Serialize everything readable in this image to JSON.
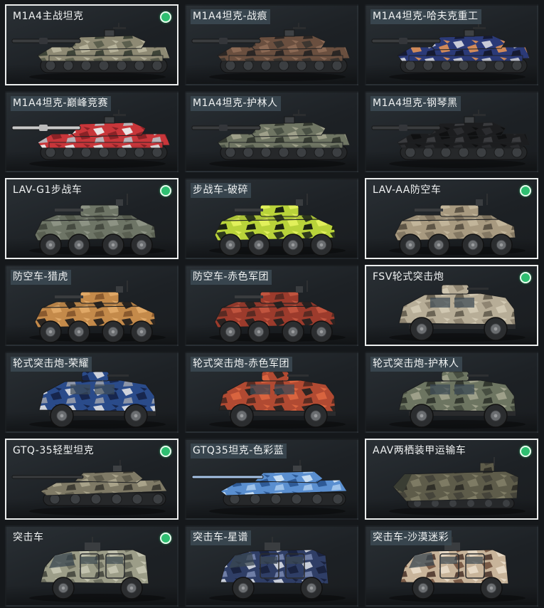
{
  "items": [
    {
      "name": "M1A4主战坦克",
      "type": "tank",
      "owned": true,
      "selected": true,
      "camo": [
        "#8e8a74",
        "#5c5f4e",
        "#b7b39b",
        "#3e4438"
      ]
    },
    {
      "name": "M1A4坦克-战痕",
      "type": "tank",
      "owned": false,
      "selected": false,
      "camo": [
        "#6a4f3f",
        "#3d3630",
        "#8c6a55",
        "#2b2624"
      ]
    },
    {
      "name": "M1A4坦克-哈夫克重工",
      "type": "tank",
      "owned": false,
      "selected": false,
      "camo": [
        "#2b3a78",
        "#c9ccd8",
        "#d08a5a",
        "#151a33"
      ]
    },
    {
      "name": "M1A4坦克-巅峰竞赛",
      "type": "tank",
      "owned": false,
      "selected": false,
      "camo": [
        "#c8363a",
        "#e9e4e4",
        "#8a2226",
        "#b9b3b8"
      ]
    },
    {
      "name": "M1A4坦克-护林人",
      "type": "tank",
      "owned": false,
      "selected": false,
      "camo": [
        "#6f7563",
        "#4a5145",
        "#9fa08a",
        "#353a31"
      ]
    },
    {
      "name": "M1A4坦克-钢琴黑",
      "type": "tank",
      "owned": false,
      "selected": false,
      "camo": [
        "#1c1d1f",
        "#2b2c2f",
        "#0f1011",
        "#3a3b3e"
      ]
    },
    {
      "name": "LAV-G1步战车",
      "type": "ifv",
      "owned": true,
      "selected": true,
      "camo": [
        "#6e7566",
        "#5a6052",
        "#8d9384",
        "#454a40"
      ]
    },
    {
      "name": "步战车-破碎",
      "type": "ifv",
      "owned": false,
      "selected": false,
      "camo": [
        "#b9d33a",
        "#2f3a1c",
        "#e1f05b",
        "#1c2312"
      ]
    },
    {
      "name": "LAV-AA防空车",
      "type": "ifv",
      "owned": true,
      "selected": true,
      "camo": [
        "#a89a80",
        "#847863",
        "#c2b59a",
        "#5e5546"
      ]
    },
    {
      "name": "防空车-猎虎",
      "type": "ifv",
      "owned": false,
      "selected": false,
      "camo": [
        "#c48a4a",
        "#2b2520",
        "#e0a866",
        "#8a5a2e"
      ]
    },
    {
      "name": "防空车-赤色军团",
      "type": "ifv",
      "owned": false,
      "selected": false,
      "camo": [
        "#9c3b2c",
        "#2a2220",
        "#c1543e",
        "#5a2a22"
      ]
    },
    {
      "name": "FSV轮式突击炮",
      "type": "apc",
      "owned": true,
      "selected": true,
      "camo": [
        "#b7ad97",
        "#8f8572",
        "#d1c8b2",
        "#6b6455"
      ]
    },
    {
      "name": "轮式突击炮-荣耀",
      "type": "apc",
      "owned": false,
      "selected": false,
      "camo": [
        "#2a4b8a",
        "#cfd3dc",
        "#17264d",
        "#8c95a8"
      ]
    },
    {
      "name": "轮式突击炮-赤色军团",
      "type": "apc",
      "owned": false,
      "selected": false,
      "camo": [
        "#b14a32",
        "#2d2522",
        "#d9643f",
        "#5a2c22"
      ]
    },
    {
      "name": "轮式突击炮-护林人",
      "type": "apc",
      "owned": false,
      "selected": false,
      "camo": [
        "#6d7561",
        "#474e41",
        "#9ea08a",
        "#33382f"
      ]
    },
    {
      "name": "GTQ-35轻型坦克",
      "type": "lighttank",
      "owned": true,
      "selected": true,
      "camo": [
        "#7f7a66",
        "#5e5b4c",
        "#a9a38a",
        "#3f3d34"
      ]
    },
    {
      "name": "GTQ35坦克-色彩蓝",
      "type": "lighttank",
      "owned": false,
      "selected": false,
      "camo": [
        "#5a8fd0",
        "#c7def4",
        "#2e5a96",
        "#9fc3ea"
      ]
    },
    {
      "name": "AAV两栖装甲运输车",
      "type": "aav",
      "owned": true,
      "selected": true,
      "camo": [
        "#5e5c4a",
        "#45443a",
        "#7e7b64",
        "#302f28"
      ]
    },
    {
      "name": "突击车",
      "type": "mrap",
      "owned": true,
      "selected": false,
      "camo": [
        "#9c9d88",
        "#6f7162",
        "#c2c2ae",
        "#4d4f45"
      ]
    },
    {
      "name": "突击车-星谱",
      "type": "mrap",
      "owned": false,
      "selected": false,
      "camo": [
        "#2f3e66",
        "#c9ced9",
        "#1a2340",
        "#6f7ea6"
      ]
    },
    {
      "name": "突击车-沙漠迷彩",
      "type": "mrap",
      "owned": false,
      "selected": false,
      "camo": [
        "#c8b49a",
        "#7b5c48",
        "#e6d8c4",
        "#5a4438"
      ]
    }
  ]
}
